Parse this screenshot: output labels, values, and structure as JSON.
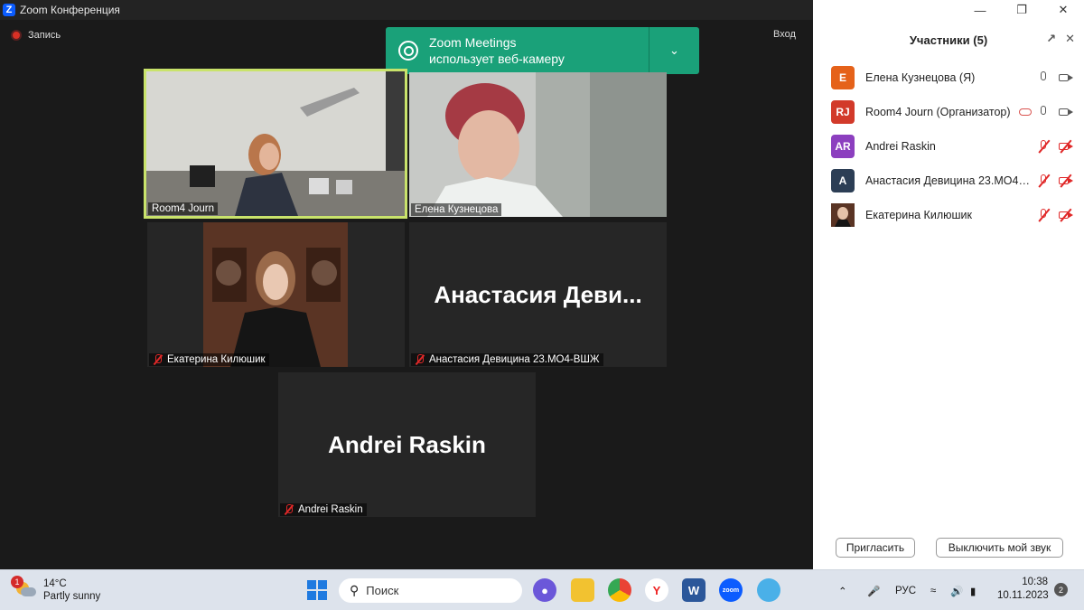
{
  "window": {
    "title": "Zoom Конференция"
  },
  "toolbar": {
    "record_label": "Запись",
    "exit_label": "Вход"
  },
  "toast": {
    "line1": "Zoom Meetings",
    "line2": "использует веб-камеру"
  },
  "tiles": {
    "room4": "Room4 Journ",
    "elena": "Елена Кузнецова",
    "ekaterina": "Екатерина Килюшик",
    "anastasia": "Анастасия Девицина 23.МО4-ВШЖ",
    "anastasia_big": "Анастасия  Деви...",
    "andrei": "Andrei Raskin",
    "andrei_big": "Andrei Raskin"
  },
  "participants": {
    "title": "Участники (5)",
    "items": [
      {
        "initials": "E",
        "name": "Елена Кузнецова (Я)",
        "color": "#e5621a",
        "muted": false
      },
      {
        "initials": "RJ",
        "name": "Room4 Journ (Организатор)",
        "color": "#d23a2a",
        "muted": false
      },
      {
        "initials": "AR",
        "name": "Andrei Raskin",
        "color": "#8c3fbf",
        "muted": true
      },
      {
        "initials": "A",
        "name": "Анастасия Девицина 23.МО4-ВШЖ",
        "color": "#2c3e55",
        "muted": true
      },
      {
        "initials": "",
        "name": "Екатерина Килюшик",
        "color": "#6b4a3a",
        "muted": true
      }
    ],
    "invite_label": "Пригласить",
    "mute_me_label": "Выключить мой звук"
  },
  "taskbar": {
    "weather_badge": "1",
    "temp": "14°C",
    "condition": "Partly sunny",
    "search_placeholder": "Поиск",
    "lang": "РУС",
    "time": "10:38",
    "date": "10.11.2023",
    "notif_count": "2",
    "zoom_label": "zoom",
    "word_label": "W"
  },
  "colors": {
    "accent": "#1aa179",
    "active_speaker": "#c9e36b",
    "mute_red": "#e02828"
  }
}
